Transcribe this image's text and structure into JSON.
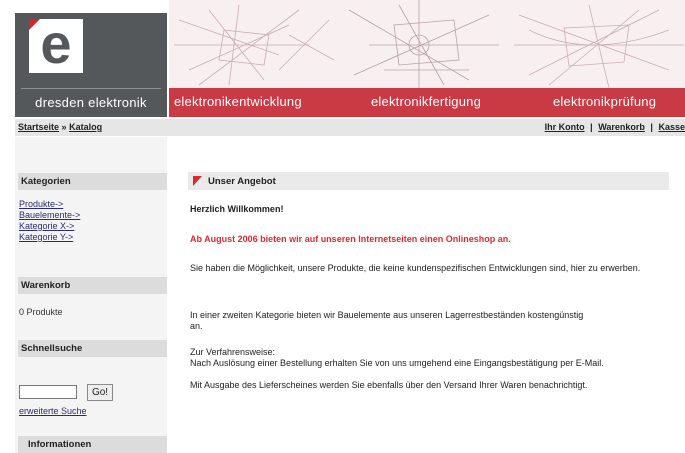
{
  "header": {
    "logo_letter": "e",
    "brand_name": "dresden elektronik",
    "banner_labels": [
      "elektronikentwicklung",
      "elektronikfertigung",
      "elektronikprüfung"
    ]
  },
  "navbar": {
    "breadcrumb": {
      "home": "Startseite",
      "separator": "»",
      "current": "Katalog"
    },
    "links": [
      "Ihr Konto",
      "Warenkorb",
      "Kasse"
    ],
    "link_separator": "|"
  },
  "sidebar": {
    "categories": {
      "title": "Kategorien",
      "items": [
        "Produkte->",
        "Bauelemente->",
        "Kategorie X->",
        "Kategorie Y->"
      ]
    },
    "cart": {
      "title": "Warenkorb",
      "text": "0 Produkte"
    },
    "quicksearch": {
      "title": "Schnellsuche",
      "input_value": "",
      "button_label": "Go!",
      "advanced_link": "erweiterte Suche"
    },
    "info": {
      "title": "Informationen"
    }
  },
  "main": {
    "title": "Unser Angebot",
    "welcome": "Herzlich Willkommen!",
    "highlight": "Ab August 2006 bieten wir auf unseren Internetseiten einen Onlineshop an.",
    "paragraph1": "Sie haben die Möglichkeit, unsere Produkte, die keine kundenspezifischen Entwicklungen sind, hier zu erwerben.",
    "paragraph2": "In einer zweiten Kategorie bieten wir Bauelemente aus unseren Lagerrestbeständen kostengünstig an.",
    "procedure": [
      "Zur Verfahrensweise:",
      "Nach Auslösung einer Bestellung erhalten Sie von uns umgehend eine Eingangsbestätigung per E-Mail.",
      "Mit Ausgabe des Lieferscheines werden Sie ebenfalls über den Versand Ihrer Waren benachrichtigt."
    ]
  },
  "colors": {
    "logo_gray": "#55585a",
    "banner_red": "#c93a45",
    "highlight_red": "#e8272d",
    "bar_gray": "#dcdcdc"
  },
  "icons": {
    "title_flag": "red-triangle-flag-icon",
    "logo_corner": "red-corner-triangle-icon"
  }
}
